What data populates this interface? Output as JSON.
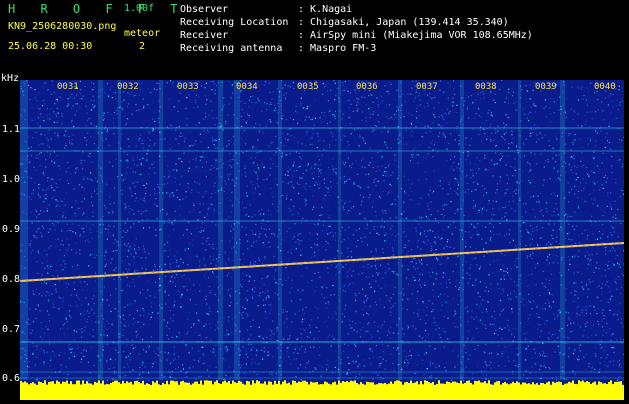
{
  "header": {
    "app_name": "H R O F F T",
    "version": "1.00f",
    "filename": "KN9_2506280030.png",
    "meteor_label": "meteor",
    "meteor_count": "2",
    "datetime": "25.06.28 00:30",
    "observer_label": "Observer",
    "observer_value": ": K.Nagai",
    "location_label": "Receiving Location",
    "location_value": ": Chigasaki, Japan (139.414 35.340)",
    "receiver_label": "Receiver",
    "receiver_value": ": AirSpy mini (Miakejima VOR 108.65MHz)",
    "antenna_label": "Receiving antenna",
    "antenna_value": ": Maspro FM-3"
  },
  "axes": {
    "unit": "kHz",
    "y_ticks": [
      "1.1",
      "1.0",
      "0.9",
      "0.8",
      "0.7",
      "0.6"
    ],
    "x_ticks": [
      "0031",
      "0032",
      "0033",
      "0034",
      "0035",
      "0036",
      "0037",
      "0038",
      "0039",
      "0040"
    ]
  },
  "colors": {
    "background": "#0a1c8c",
    "noise_light": "#3a78ff",
    "noise_cyan": "#30e8ff",
    "trace": "#ffe060",
    "floor": "#ffff00",
    "label_green": "#2fe07a",
    "label_yellow": "#ffff40"
  }
}
